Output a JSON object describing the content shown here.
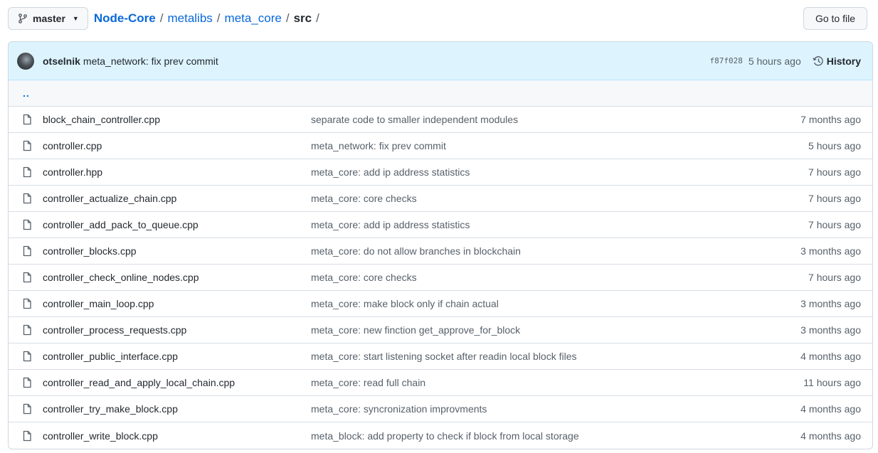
{
  "branch": {
    "name": "master"
  },
  "breadcrumb": {
    "repo": "Node-Core",
    "path1": "metalibs",
    "path2": "meta_core",
    "current": "src",
    "separator": "/"
  },
  "goto_label": "Go to file",
  "commit": {
    "author": "otselnik",
    "message": "meta_network: fix prev commit",
    "sha": "f87f028",
    "time": "5 hours ago",
    "history_label": "History"
  },
  "parent_link": "..",
  "files": [
    {
      "name": "block_chain_controller.cpp",
      "message": "separate code to smaller independent modules",
      "age": "7 months ago"
    },
    {
      "name": "controller.cpp",
      "message": "meta_network: fix prev commit",
      "age": "5 hours ago"
    },
    {
      "name": "controller.hpp",
      "message": "meta_core: add ip address statistics",
      "age": "7 hours ago"
    },
    {
      "name": "controller_actualize_chain.cpp",
      "message": "meta_core: core checks",
      "age": "7 hours ago"
    },
    {
      "name": "controller_add_pack_to_queue.cpp",
      "message": "meta_core: add ip address statistics",
      "age": "7 hours ago"
    },
    {
      "name": "controller_blocks.cpp",
      "message": "meta_core: do not allow branches in blockchain",
      "age": "3 months ago"
    },
    {
      "name": "controller_check_online_nodes.cpp",
      "message": "meta_core: core checks",
      "age": "7 hours ago"
    },
    {
      "name": "controller_main_loop.cpp",
      "message": "meta_core: make block only if chain actual",
      "age": "3 months ago"
    },
    {
      "name": "controller_process_requests.cpp",
      "message": "meta_core: new finction get_approve_for_block",
      "age": "3 months ago"
    },
    {
      "name": "controller_public_interface.cpp",
      "message": "meta_core: start listening socket after readin local block files",
      "age": "4 months ago"
    },
    {
      "name": "controller_read_and_apply_local_chain.cpp",
      "message": "meta_core: read full chain",
      "age": "11 hours ago"
    },
    {
      "name": "controller_try_make_block.cpp",
      "message": "meta_core: syncronization improvments",
      "age": "4 months ago"
    },
    {
      "name": "controller_write_block.cpp",
      "message": "meta_block: add property to check if block from local storage",
      "age": "4 months ago"
    }
  ],
  "colors": {
    "link": "#0969da",
    "commit_bar_bg": "#ddf4ff",
    "border": "#d0d7de",
    "muted": "#57606a"
  },
  "icons": {
    "branch": "git-branch-icon",
    "caret": "chevron-down-icon",
    "history": "history-clock-icon",
    "file": "file-icon"
  }
}
